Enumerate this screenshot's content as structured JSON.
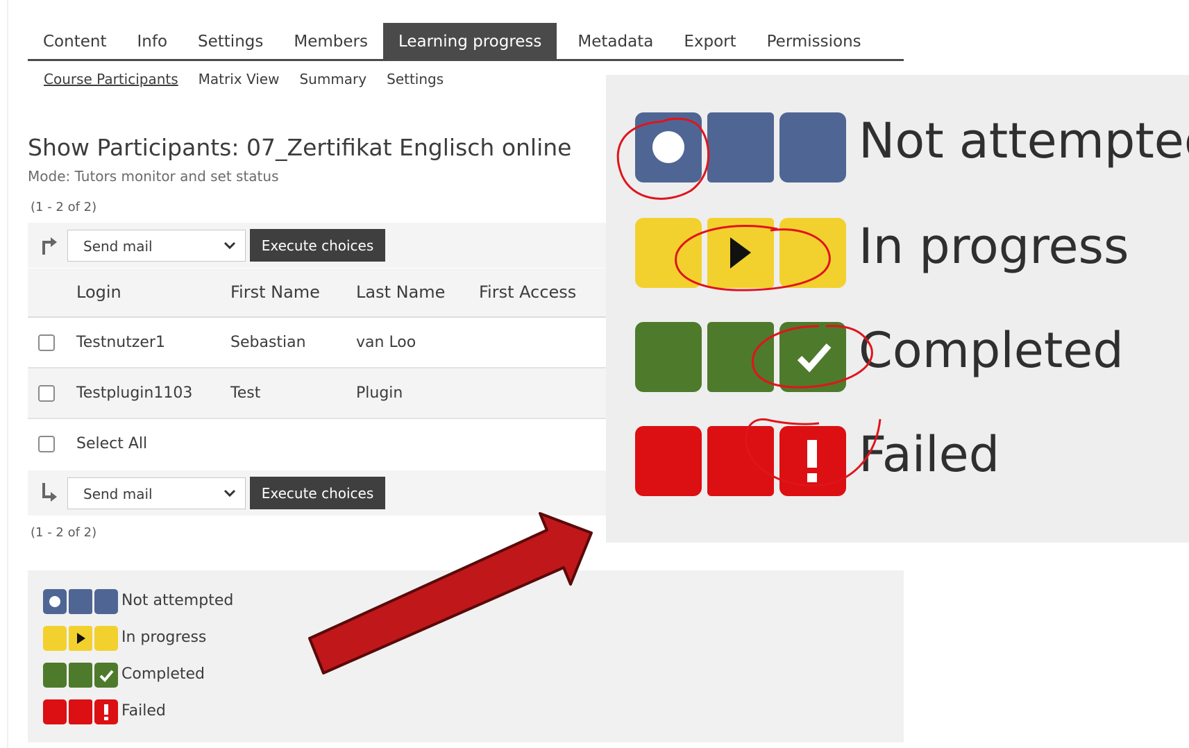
{
  "tabs": [
    {
      "label": "Content",
      "active": false
    },
    {
      "label": "Info",
      "active": false
    },
    {
      "label": "Settings",
      "active": false
    },
    {
      "label": "Members",
      "active": false
    },
    {
      "label": "Learning progress",
      "active": true
    },
    {
      "label": "Metadata",
      "active": false
    },
    {
      "label": "Export",
      "active": false
    },
    {
      "label": "Permissions",
      "active": false
    }
  ],
  "subtabs": [
    {
      "label": "Course Participants",
      "active": true
    },
    {
      "label": "Matrix View",
      "active": false
    },
    {
      "label": "Summary",
      "active": false
    },
    {
      "label": "Settings",
      "active": false
    }
  ],
  "page": {
    "title": "Show Participants: 07_Zertifikat Englisch online",
    "mode": "Mode: Tutors monitor and set status",
    "pager_top": "(1 - 2 of 2)",
    "pager_bottom": "(1 - 2 of 2)"
  },
  "actions": {
    "select_value": "Send mail",
    "execute_label": "Execute choices",
    "top_icon": "arrow-turn-right-icon",
    "bottom_icon": "arrow-turn-down-right-icon"
  },
  "table": {
    "columns": [
      "Login",
      "First Name",
      "Last Name",
      "First Access"
    ],
    "rows": [
      {
        "login": "Testnutzer1",
        "first_name": "Sebastian",
        "last_name": "van Loo",
        "first_access": ""
      },
      {
        "login": "Testplugin1103",
        "first_name": "Test",
        "last_name": "Plugin",
        "first_access": ""
      }
    ],
    "select_all_label": "Select All"
  },
  "legend": {
    "items": [
      {
        "label": "Not attempted",
        "color": "#4f6694",
        "icon": "circle-icon"
      },
      {
        "label": "In progress",
        "color": "#f2d12e",
        "icon": "play-icon"
      },
      {
        "label": "Completed",
        "color": "#4e7a2c",
        "icon": "check-icon"
      },
      {
        "label": "Failed",
        "color": "#dc0f12",
        "icon": "exclamation-icon"
      }
    ]
  },
  "colors": {
    "tab_active_bg": "#4a4a4a",
    "button_bg": "#3f3f3f",
    "arrow_fill": "#c0171b",
    "annotation_stroke": "#e0141c"
  }
}
